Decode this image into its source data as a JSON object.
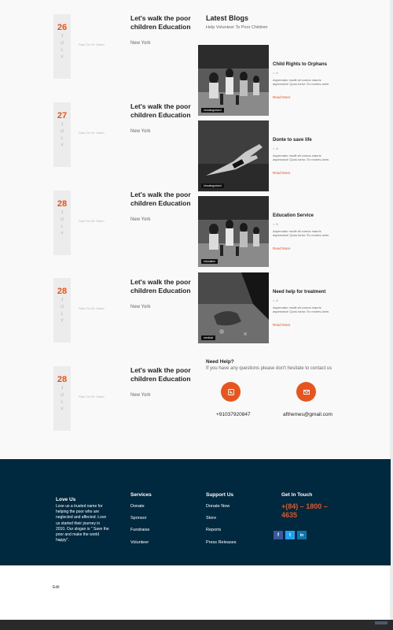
{
  "events": [
    {
      "day": "26",
      "month": [
        "J",
        "U",
        "L",
        "Y"
      ],
      "time": "Start On 09 :00am",
      "title": "Let's walk the poor children Education",
      "place": "New York"
    },
    {
      "day": "27",
      "month": [
        "J",
        "U",
        "L",
        "Y"
      ],
      "time": "Start On 09 :00am",
      "title": "Let's walk the poor children Education",
      "place": "New York"
    },
    {
      "day": "28",
      "month": [
        "J",
        "U",
        "L",
        "Y"
      ],
      "time": "Start On 09 :00am",
      "title": "Let's walk the poor children Education",
      "place": "New York"
    },
    {
      "day": "28",
      "month": [
        "J",
        "U",
        "L",
        "Y"
      ],
      "time": "Start On 09 :00am",
      "title": "Let's walk the poor children Education",
      "place": "New York"
    },
    {
      "day": "28",
      "month": [
        "J",
        "U",
        "L",
        "Y"
      ],
      "time": "Start On 09 :00am",
      "title": "Let's walk the poor children Education",
      "place": "New York"
    }
  ],
  "blogs": {
    "heading": "Latest Blogs",
    "subheading": "Help Volunteer To Poor Children",
    "posts": [
      {
        "title": "Child Rights to Orphans",
        "comments": "0",
        "excerpt": "Aspernatur modit sit cumus mauris aspernatur! Quos tortor. Ex reories anim.",
        "more": "Read More",
        "tag": "Uncategorized",
        "image": "children-running-photo"
      },
      {
        "title": "Donte to save life",
        "comments": "0",
        "excerpt": "Aspernatur modit sit cumus mauris aspernatur! Quos tortor. Ex reories anim.",
        "more": "Read More",
        "tag": "Uncategorized",
        "image": "outstretched-hand-photo"
      },
      {
        "title": "Education Service",
        "comments": "0",
        "excerpt": "Aspernatur modit sit cumus mauris aspernatur! Quos tortor. Ex reories anim.",
        "more": "Read More",
        "tag": "education",
        "image": "children-running-photo"
      },
      {
        "title": "Need help for treatment",
        "comments": "0",
        "excerpt": "Aspernatur modit sit cumus mauris aspernatur! Quos tortor. Ex reories anim.",
        "more": "Read More",
        "tag": "medical",
        "image": "hand-on-ground-photo"
      }
    ]
  },
  "help": {
    "heading": "Need Help?",
    "text": "If you have any questions please don't hesitate to contact us",
    "phone": "+91037920847",
    "email": "afthemes@gmail.com",
    "phone_icon": "phone-icon",
    "email_icon": "mail-icon"
  },
  "footer": {
    "about": {
      "heading": "Love Us",
      "text": "Love us a trusted name for helping the poor who are neglected and affected. Love us started their journey in 2010. Our slogan is \" Save the poor and make the world happy\"."
    },
    "services": {
      "heading": "Services",
      "links": [
        "Donate",
        "Sponsor",
        "Fundraise",
        "Volunteer"
      ]
    },
    "support": {
      "heading": "Support Us",
      "links": [
        "Donate Now",
        "Store",
        "Reports",
        "Press Releases"
      ]
    },
    "contact": {
      "heading": "Get In Touch",
      "phone": "+(84) – 1800 – 4635"
    },
    "social": [
      {
        "icon": "facebook-icon",
        "glyph": "f",
        "color": "#3b5998"
      },
      {
        "icon": "twitter-icon",
        "glyph": "t",
        "color": "#1da1f2"
      },
      {
        "icon": "linkedin-icon",
        "glyph": "in",
        "color": "#0e76a8"
      }
    ]
  },
  "edit_link": "Edit",
  "colors": {
    "accent": "#e8541d",
    "footer_bg": "#002940",
    "main_bg": "#f9f9f9"
  }
}
